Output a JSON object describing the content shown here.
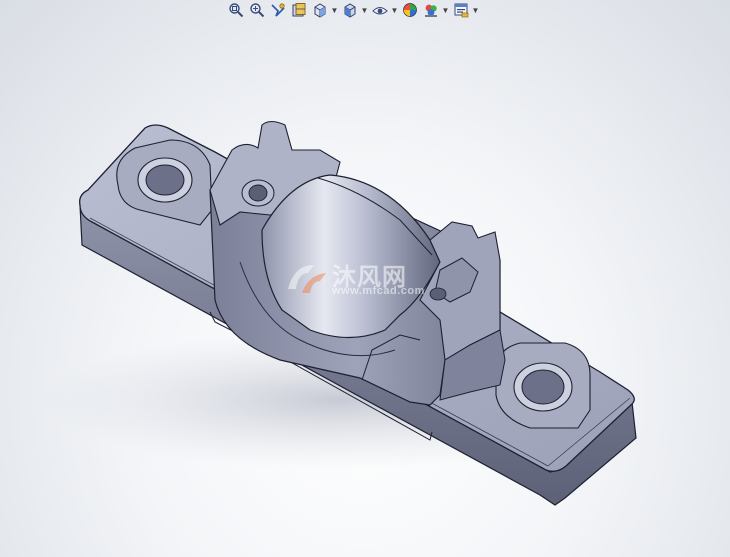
{
  "app": {
    "colors": {
      "background_top": "#d9dde4",
      "background_center": "#ffffff",
      "model_light": "#b7bcd0",
      "model_mid": "#8d92a8",
      "model_dark": "#4a4e62",
      "edge": "#1e2030"
    }
  },
  "toolbar": {
    "items": [
      {
        "icon": "zoom-to-fit-icon",
        "has_dropdown": false
      },
      {
        "icon": "zoom-to-area-icon",
        "has_dropdown": false
      },
      {
        "icon": "previous-view-icon",
        "has_dropdown": false
      },
      {
        "icon": "section-view-icon",
        "has_dropdown": false
      },
      {
        "icon": "view-orientation-icon",
        "has_dropdown": true
      },
      {
        "icon": "display-style-icon",
        "has_dropdown": true
      },
      {
        "icon": "hide-show-items-icon",
        "has_dropdown": true
      },
      {
        "icon": "edit-appearance-icon",
        "has_dropdown": false
      },
      {
        "icon": "apply-scene-icon",
        "has_dropdown": true
      },
      {
        "icon": "view-settings-icon",
        "has_dropdown": true
      }
    ]
  },
  "model": {
    "name": "pillow-block-bearing-housing"
  },
  "watermark": {
    "title": "沐风网",
    "subtitle": "www.mfcad.com"
  }
}
